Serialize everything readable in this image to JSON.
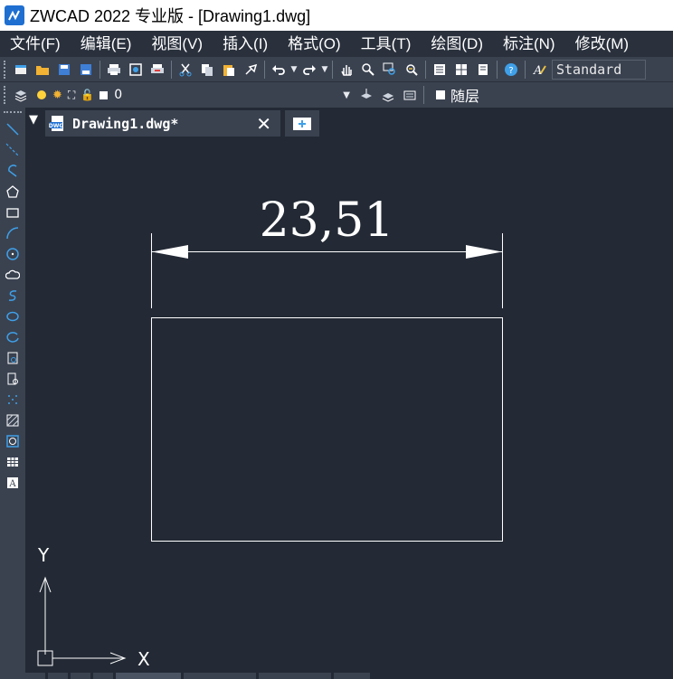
{
  "window": {
    "title": "ZWCAD 2022 专业版 - [Drawing1.dwg]"
  },
  "menu": [
    {
      "label": "文件(F)"
    },
    {
      "label": "编辑(E)"
    },
    {
      "label": "视图(V)"
    },
    {
      "label": "插入(I)"
    },
    {
      "label": "格式(O)"
    },
    {
      "label": "工具(T)"
    },
    {
      "label": "绘图(D)"
    },
    {
      "label": "标注(N)"
    },
    {
      "label": "修改(M)"
    }
  ],
  "toolbar": {
    "text_style": "Standard",
    "icons": [
      "new-icon",
      "open-icon",
      "save-icon",
      "save-as-icon",
      "print-icon",
      "plot-preview-icon",
      "publish-icon",
      "cut-icon",
      "copy-icon",
      "paste-icon",
      "match-properties-icon",
      "undo-icon",
      "redo-icon",
      "pan-icon",
      "zoom-realtime-icon",
      "zoom-window-icon",
      "zoom-previous-icon",
      "properties-icon",
      "design-center-icon",
      "tool-palettes-icon",
      "help-icon",
      "text-style-icon"
    ]
  },
  "layer_bar": {
    "current_layer": "0",
    "color": "随层"
  },
  "document_tab": {
    "name": "Drawing1.dwg*"
  },
  "drawing": {
    "dimension_text": "23,51",
    "ucs_x": "X",
    "ucs_y": "Y"
  },
  "left_tools": [
    "line-icon",
    "construction-line-icon",
    "polyline-icon",
    "polygon-icon",
    "rectangle-icon",
    "arc-icon",
    "circle-icon",
    "revision-cloud-icon",
    "spline-icon",
    "ellipse-icon",
    "ellipse-arc-icon",
    "insert-block-icon",
    "make-block-icon",
    "point-icon",
    "hatch-icon",
    "region-icon",
    "table-icon",
    "multiline-text-icon"
  ],
  "colors": {
    "background": "#232a35",
    "toolbar": "#3a4250",
    "menubar": "#2a313d",
    "accent_blue": "#3fa0e8"
  }
}
